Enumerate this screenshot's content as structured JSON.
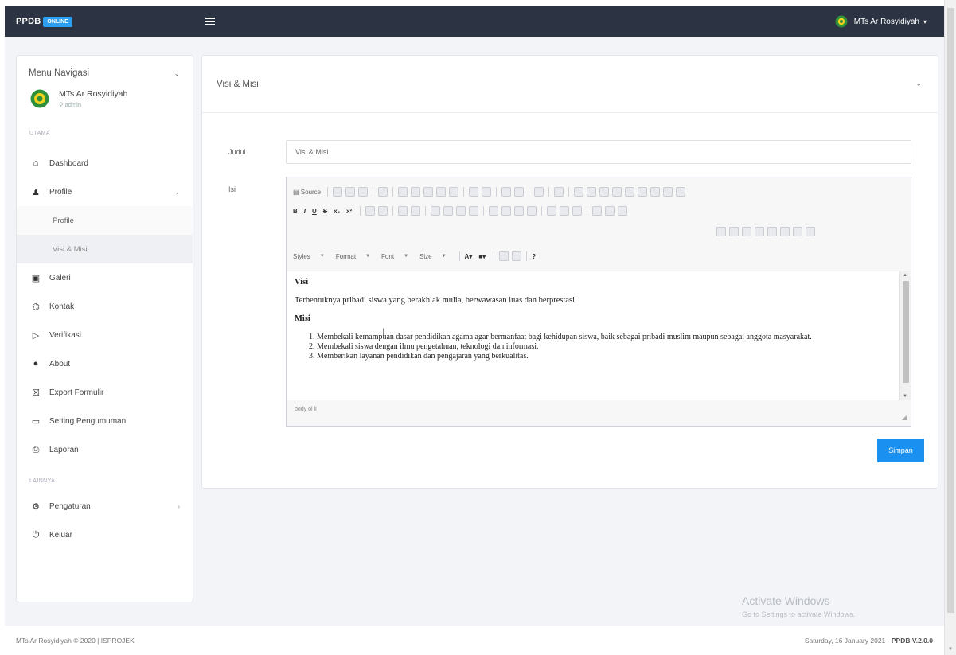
{
  "topbar": {
    "brand": "PPDB",
    "badge": "ONLINE",
    "user_name": "MTs Ar Rosyidiyah"
  },
  "sidebar": {
    "title": "Menu Navigasi",
    "user_name": "MTs Ar Rosyidiyah",
    "user_role": "admin",
    "section_main": "UTAMA",
    "section_other": "LAINNYA",
    "items": [
      {
        "label": "Dashboard",
        "icon": "home-icon"
      },
      {
        "label": "Profile",
        "icon": "user-icon"
      },
      {
        "label": "Galeri",
        "icon": "image-icon"
      },
      {
        "label": "Kontak",
        "icon": "bank-icon"
      },
      {
        "label": "Verifikasi",
        "icon": "tag-icon"
      },
      {
        "label": "About",
        "icon": "info-icon"
      },
      {
        "label": "Export Formulir",
        "icon": "file-excel-icon"
      },
      {
        "label": "Setting Pengumuman",
        "icon": "monitor-icon"
      },
      {
        "label": "Laporan",
        "icon": "print-icon"
      },
      {
        "label": "Pengaturan",
        "icon": "gear-icon"
      },
      {
        "label": "Keluar",
        "icon": "power-icon"
      }
    ],
    "subitems": [
      {
        "label": "Profile"
      },
      {
        "label": "Visi & Misi"
      }
    ]
  },
  "card": {
    "title": "Visi & Misi",
    "judul_label": "Judul",
    "judul_value": "Visi & Misi",
    "isi_label": "Isi",
    "toolbar": {
      "source": "Source",
      "styles": "Styles",
      "format": "Format",
      "font": "Font",
      "size": "Size"
    },
    "content": {
      "visi_heading": "Visi",
      "visi_text": "Terbentuknya pribadi siswa yang berakhlak mulia, berwawasan luas dan berprestasi.",
      "misi_heading": "Misi",
      "misi_items": [
        "Membekali kemampuan dasar pendidikan agama agar bermanfaat bagi kehidupan siswa, baik sebagai pribadi muslim maupun sebagai anggota masyarakat.",
        "Membekali siswa dengan ilmu pengetahuan, teknologi dan informasi.",
        "Memberikan layanan pendidikan dan pengajaran yang berkualitas."
      ]
    },
    "status_path": "body ol li",
    "save_label": "Simpan"
  },
  "watermark": {
    "line1": "Activate Windows",
    "line2": "Go to Settings to activate Windows."
  },
  "footer": {
    "left": "MTs Ar Rosyidiyah © 2020 | ISPROJEK",
    "date": "Saturday, 16 January 2021 -",
    "version": "PPDB V.2.0.0"
  }
}
